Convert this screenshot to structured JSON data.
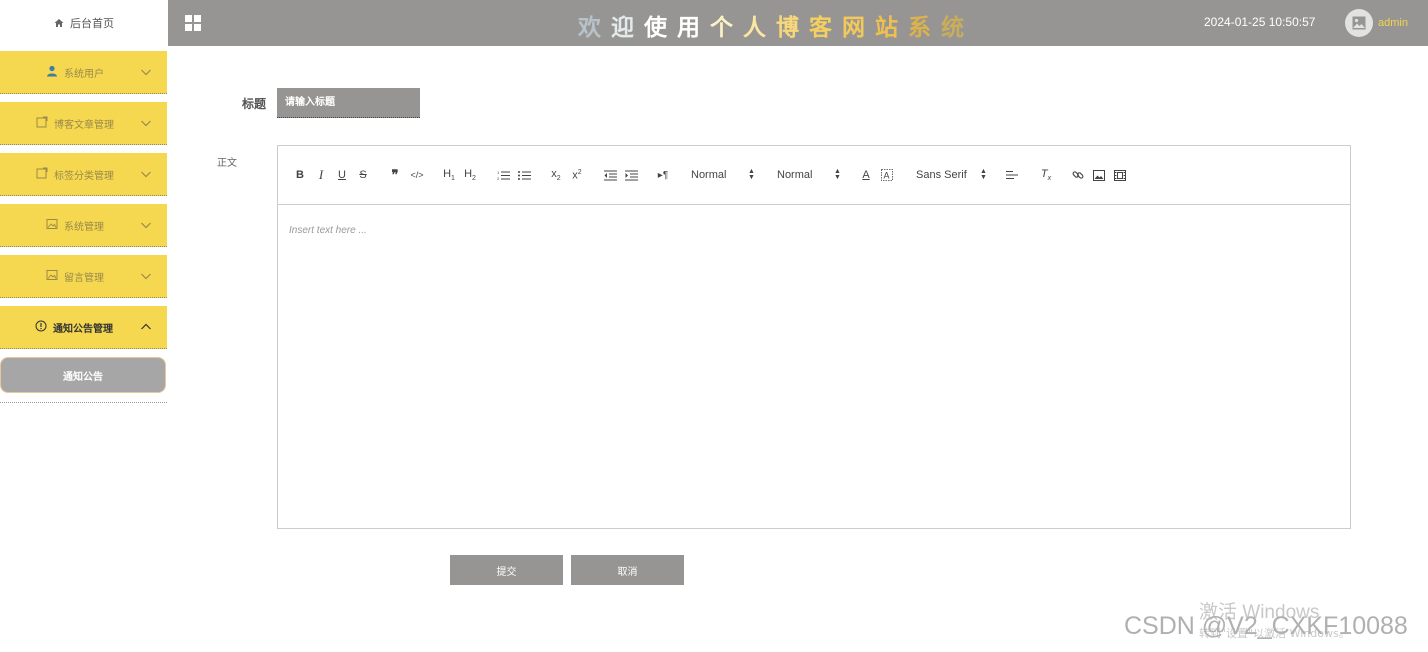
{
  "header": {
    "title_chars": [
      {
        "ch": "欢",
        "color": "#b7c3c9"
      },
      {
        "ch": "迎",
        "color": "#e4e9ec"
      },
      {
        "ch": "使",
        "color": "#ffffff"
      },
      {
        "ch": "用",
        "color": "#ffffff"
      },
      {
        "ch": "个",
        "color": "#fdf1c6"
      },
      {
        "ch": "人",
        "color": "#fbe7a4"
      },
      {
        "ch": "博",
        "color": "#f8d87a"
      },
      {
        "ch": "客",
        "color": "#f5d05f"
      },
      {
        "ch": "网",
        "color": "#f3c95a"
      },
      {
        "ch": "站",
        "color": "#efc04e"
      },
      {
        "ch": "系",
        "color": "#dcb34a"
      },
      {
        "ch": "统",
        "color": "#c9ad5a"
      }
    ],
    "datetime": "2024-01-25 10:50:57",
    "user": "admin"
  },
  "sidebar": {
    "home_label": "后台首页",
    "items": [
      {
        "label": "系统用户",
        "icon": "user-icon",
        "open": false
      },
      {
        "label": "博客文章管理",
        "icon": "article-icon",
        "open": false
      },
      {
        "label": "标签分类管理",
        "icon": "tag-icon",
        "open": false
      },
      {
        "label": "系统管理",
        "icon": "image-icon",
        "open": false
      },
      {
        "label": "留言管理",
        "icon": "image-icon",
        "open": false
      },
      {
        "label": "通知公告管理",
        "icon": "info-icon",
        "open": true
      }
    ],
    "sub_item": "通知公告"
  },
  "form": {
    "title_label": "标题",
    "title_placeholder": "请输入标题",
    "body_label": "正文",
    "editor_placeholder": "Insert text here ...",
    "toolbar": {
      "size": "Normal",
      "header": "Normal",
      "font": "Sans Serif"
    },
    "submit_label": "提交",
    "cancel_label": "取消"
  },
  "watermark": {
    "csdn": "CSDN @V2_CXKF10088",
    "windows_line1": "激活 Windows",
    "windows_line2": "转到\"设置\"以激活 Windows。"
  },
  "colors": {
    "header_bg": "#969594",
    "sidebar_item_bg": "#f5d850",
    "accent_yellow": "#f3d54e"
  }
}
